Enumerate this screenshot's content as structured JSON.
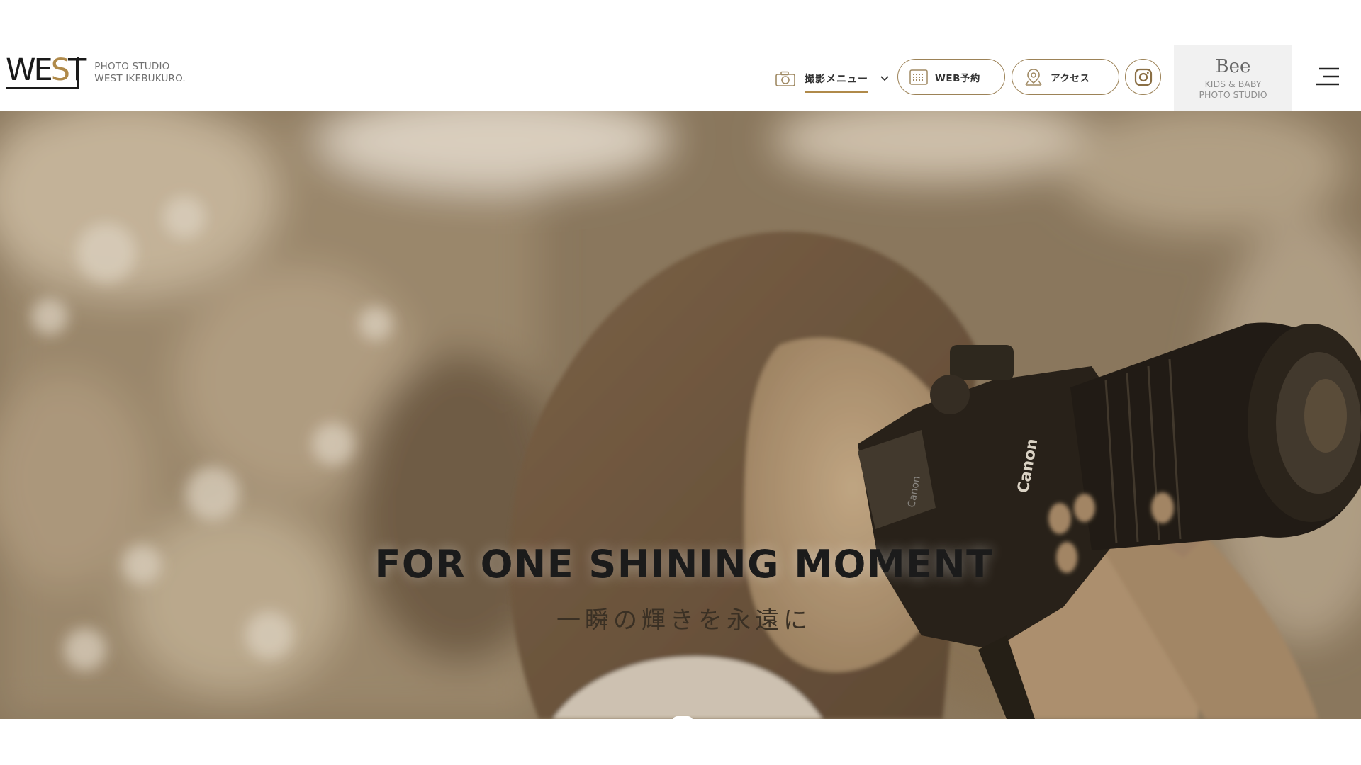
{
  "header": {
    "logo": {
      "mark": "WEST",
      "line1": "PHOTO STUDIO",
      "line2": "WEST IKEBUKURO."
    },
    "menu_label": "撮影メニュー",
    "web_reserve_label": "WEB予約",
    "access_label": "アクセス",
    "bee": {
      "logo": "Bee",
      "line1": "KIDS & BABY",
      "line2": "PHOTO STUDIO"
    }
  },
  "hero": {
    "title": "FOR ONE SHINING MOMENT",
    "subtitle": "一瞬の輝きを永遠に"
  },
  "colors": {
    "accent": "#b08a4a",
    "pill_border": "#9c8257",
    "sepia_dark": "#3a3024"
  },
  "icons": [
    "camera-icon",
    "chevron-down-icon",
    "calendar-icon",
    "map-pin-icon",
    "instagram-icon",
    "hamburger-icon"
  ]
}
